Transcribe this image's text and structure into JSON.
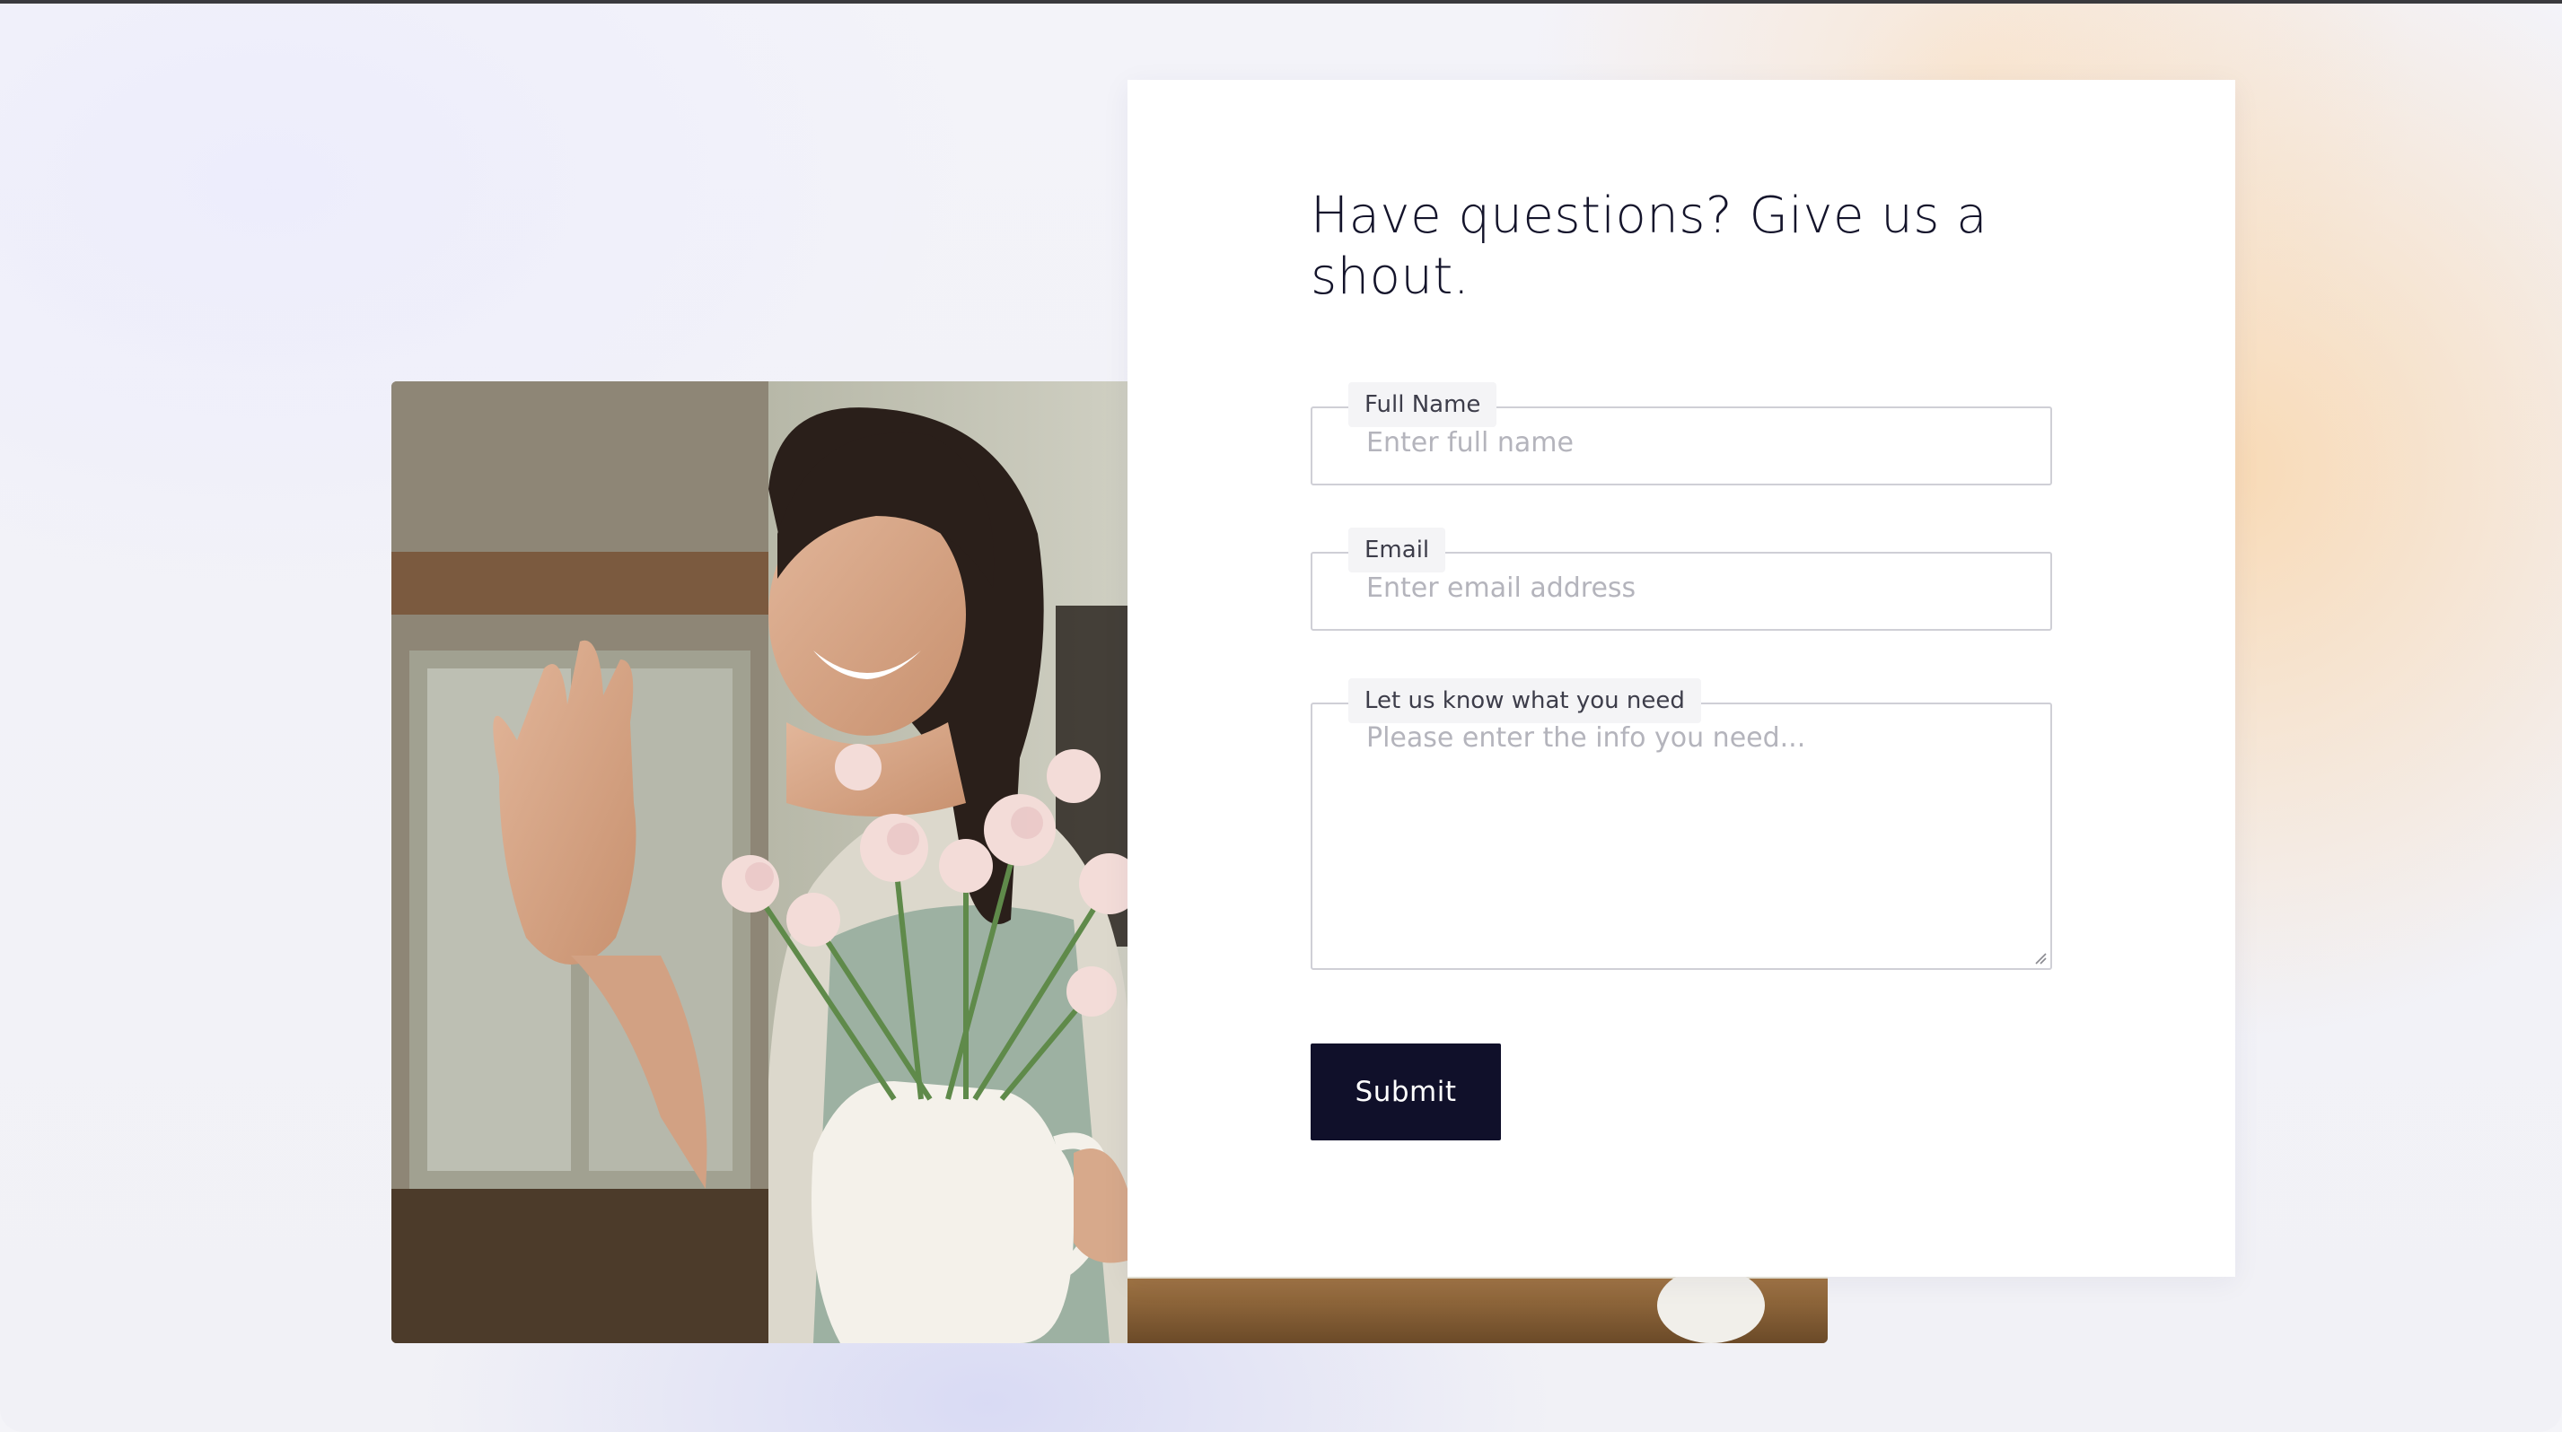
{
  "contact_form": {
    "heading": "Have questions? Give us a shout.",
    "fields": {
      "full_name": {
        "label": "Full Name",
        "placeholder": "Enter full name"
      },
      "email": {
        "label": "Email",
        "placeholder": "Enter email address"
      },
      "message": {
        "label": "Let us know what you need",
        "placeholder": "Please enter the info you need..."
      }
    },
    "submit_label": "Submit"
  },
  "colors": {
    "submit_bg": "#10102a",
    "heading_text": "#14142b",
    "input_border": "#cfcfd6",
    "placeholder_text": "#b4b4bc"
  },
  "photo": {
    "subject": "smiling florist waving while holding a white pitcher of carnations"
  }
}
